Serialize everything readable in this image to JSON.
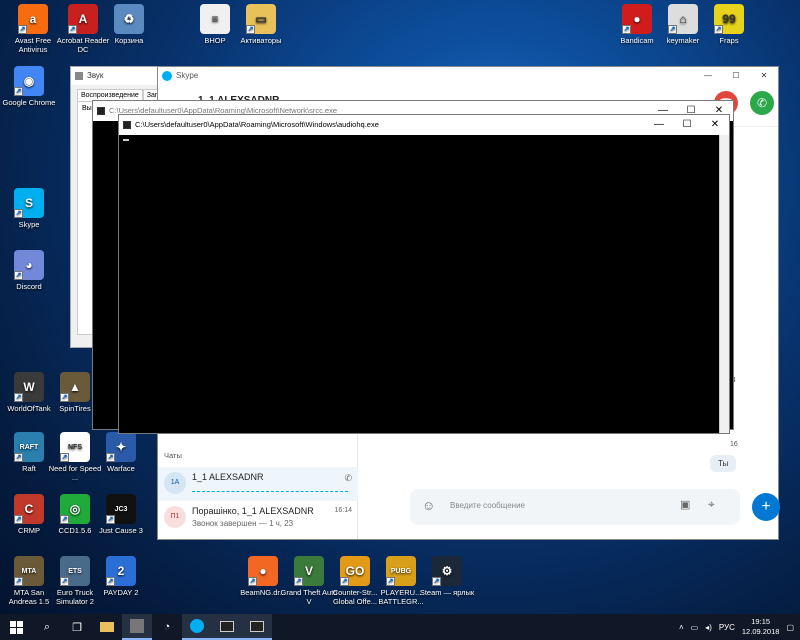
{
  "desktop": {
    "icons": [
      {
        "id": "avast",
        "label": "Avast Free Antivirus",
        "icon": "avast-icon",
        "color": "#f76c0e"
      },
      {
        "id": "acrobat",
        "label": "Acrobat Reader DC",
        "icon": "acrobat-icon",
        "color": "#c81f1f"
      },
      {
        "id": "recycle",
        "label": "Корзина",
        "icon": "recycle-bin-icon",
        "color": "#5a8ac0"
      },
      {
        "id": "vnop",
        "label": "ВНОР",
        "icon": "document-icon",
        "color": "#f0f0f0"
      },
      {
        "id": "activators",
        "label": "Активаторы",
        "icon": "folder-icon",
        "color": "#e8c15a"
      },
      {
        "id": "bandicam",
        "label": "Bandicam",
        "icon": "bandicam-icon",
        "color": "#d11c1c"
      },
      {
        "id": "keymaker",
        "label": "keymaker",
        "icon": "keymaker-icon",
        "color": "#dddddd"
      },
      {
        "id": "fraps",
        "label": "Fraps",
        "icon": "fraps-icon",
        "color": "#e7d31c"
      },
      {
        "id": "chrome",
        "label": "Google Chrome",
        "icon": "chrome-icon",
        "color": "#4285f4"
      },
      {
        "id": "skype",
        "label": "Skype",
        "icon": "skype-icon",
        "color": "#00aff0"
      },
      {
        "id": "discord",
        "label": "Discord",
        "icon": "discord-icon",
        "color": "#7289da"
      },
      {
        "id": "wot",
        "label": "WorldOfTank",
        "icon": "world-of-tanks-icon",
        "color": "#3a3a3a"
      },
      {
        "id": "spintires",
        "label": "SpinTires",
        "icon": "spintires-icon",
        "color": "#6a5a3a"
      },
      {
        "id": "raft",
        "label": "Raft",
        "icon": "raft-icon",
        "color": "#2a7fae"
      },
      {
        "id": "nfs",
        "label": "Need for Speed ...",
        "icon": "need-for-speed-icon",
        "color": "#ffffff"
      },
      {
        "id": "warface",
        "label": "Warface",
        "icon": "warface-icon",
        "color": "#2b5aa8"
      },
      {
        "id": "crmp",
        "label": "CRMP",
        "icon": "crmp-icon",
        "color": "#c0392b"
      },
      {
        "id": "ccd",
        "label": "CCD1.5.6",
        "icon": "ccd-icon",
        "color": "#1faa3a"
      },
      {
        "id": "jc3",
        "label": "Just Cause 3",
        "icon": "just-cause-3-icon",
        "color": "#111111"
      },
      {
        "id": "mta",
        "label": "MTA San Andreas 1.5",
        "icon": "mta-icon",
        "color": "#6b5a3a"
      },
      {
        "id": "ets",
        "label": "Euro Truck Simulator 2",
        "icon": "euro-truck-icon",
        "color": "#4a6a8a"
      },
      {
        "id": "payday",
        "label": "PAYDAY 2",
        "icon": "payday-icon",
        "color": "#2b6fd6"
      },
      {
        "id": "beamng",
        "label": "BeamNG.dr...",
        "icon": "beamng-icon",
        "color": "#f26722"
      },
      {
        "id": "gta",
        "label": "Grand Theft Auto V",
        "icon": "gta-icon",
        "color": "#3b7a3b"
      },
      {
        "id": "csgo",
        "label": "Counter-Str... Global Offe...",
        "icon": "csgo-icon",
        "color": "#e39b17"
      },
      {
        "id": "pubg",
        "label": "PLAYERU... BATTLEGR...",
        "icon": "pubg-icon",
        "color": "#d8a018"
      },
      {
        "id": "steam",
        "label": "Steam — ярлык",
        "icon": "steam-icon",
        "color": "#1b2838"
      }
    ]
  },
  "sound_dialog": {
    "title": "Звук",
    "tabs": [
      "Воспроизведение",
      "Запи"
    ],
    "partial_label": "Выбе"
  },
  "skype": {
    "title": "Skype",
    "contact_name": "1_1 ALEXSADNR",
    "chats_label": "Чаты",
    "chats": [
      {
        "avatar": "1A",
        "name": "1_1 ALEXSADNR",
        "subtitle": "",
        "time": ""
      },
      {
        "avatar": "П1",
        "name": "Порашінко, 1_1 ALEXSADNR",
        "subtitle": "Звонок завершен — 1 ч, 23",
        "time": "16:14"
      }
    ],
    "message_placeholder": "Введите сообщение",
    "bubble_text": "Ты",
    "hint_14": "14",
    "hint_14b": "14",
    "hint_16": "16"
  },
  "console_back": {
    "title": "C:\\Users\\defaultuser0\\AppData\\Roaming\\Microsoft\\Network\\srcc.exe"
  },
  "console_front": {
    "title": "C:\\Users\\defaultuser0\\AppData\\Roaming\\Microsoft\\Windows\\audiohq.exe"
  },
  "taskbar": {
    "language": "РУС",
    "time": "19:15",
    "date": "12.09.2018"
  }
}
